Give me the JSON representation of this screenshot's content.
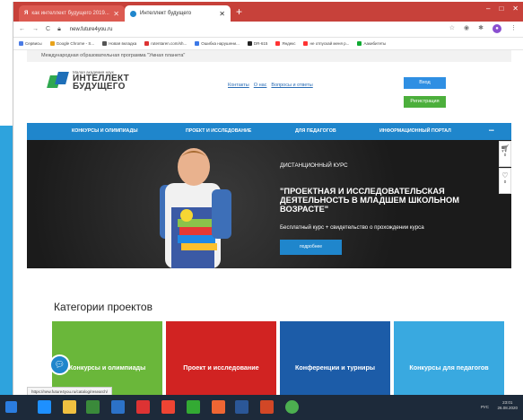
{
  "browser": {
    "tabs": [
      {
        "label": "как интеллект будущего 2019... "
      },
      {
        "label": "Интеллект будущего"
      }
    ],
    "url": "new.future4you.ru",
    "bookmarks": [
      "Сервисы",
      "Google Chrome - S...",
      "Новая вкладка",
      "rutentaren.com/sh...",
      "Ошибка нарушени...",
      "DR-615",
      "Яндекс",
      "не отпускай меня р...",
      "Аакибитеты"
    ]
  },
  "site": {
    "top_line": "Международная образовательная программа \"Умная планета\"",
    "logo_small": "Малая академия наук",
    "logo_line1": "ИНТЕЛЛЕКТ",
    "logo_line2": "БУДУЩЕГО",
    "links": [
      "Контакты",
      "О нас",
      "Вопросы и ответы"
    ],
    "login_label": "Вход",
    "register_label": "Регистрация",
    "nav": [
      "КОНКУРСЫ И ОЛИМПИАДЫ",
      "ПРОЕКТ И ИССЛЕДОВАНИЕ",
      "ДЛЯ ПЕДАГОГОВ",
      "ИНФОРМАЦИОННЫЙ ПОРТАЛ",
      "•••"
    ]
  },
  "hero": {
    "kicker": "ДИСТАНЦИОННЫЙ КУРС",
    "title": "\"ПРОЕКТНАЯ И ИССЛЕДОВАТЕЛЬСКАЯ ДЕЯТЕЛЬНОСТЬ В МЛАДШЕМ ШКОЛЬНОМ ВОЗРАСТЕ\"",
    "subtitle": "Бесплатный курс + свидетельство о прохождении курса",
    "button": "подробнее",
    "cart_count": "0",
    "fav_count": "0"
  },
  "categories": {
    "title": "Категории проектов",
    "cards": [
      {
        "label": "Конкурсы и олимпиады"
      },
      {
        "label": "Проект и исследование"
      },
      {
        "label": "Конференции и турниры"
      },
      {
        "label": "Конкурсы для педагогов"
      }
    ]
  },
  "status_url": "https://new.future4you.ru/catalog/research/",
  "taskbar": {
    "lang": "РУС",
    "time": "23:01",
    "date": "26.08.2020"
  },
  "colors": {
    "nav_blue": "#1f86cc",
    "tab_red": "#c7413a",
    "card_green": "#6ab73a",
    "card_red": "#d12322",
    "card_navy": "#1c5ca8",
    "card_sky": "#39a9e0"
  }
}
